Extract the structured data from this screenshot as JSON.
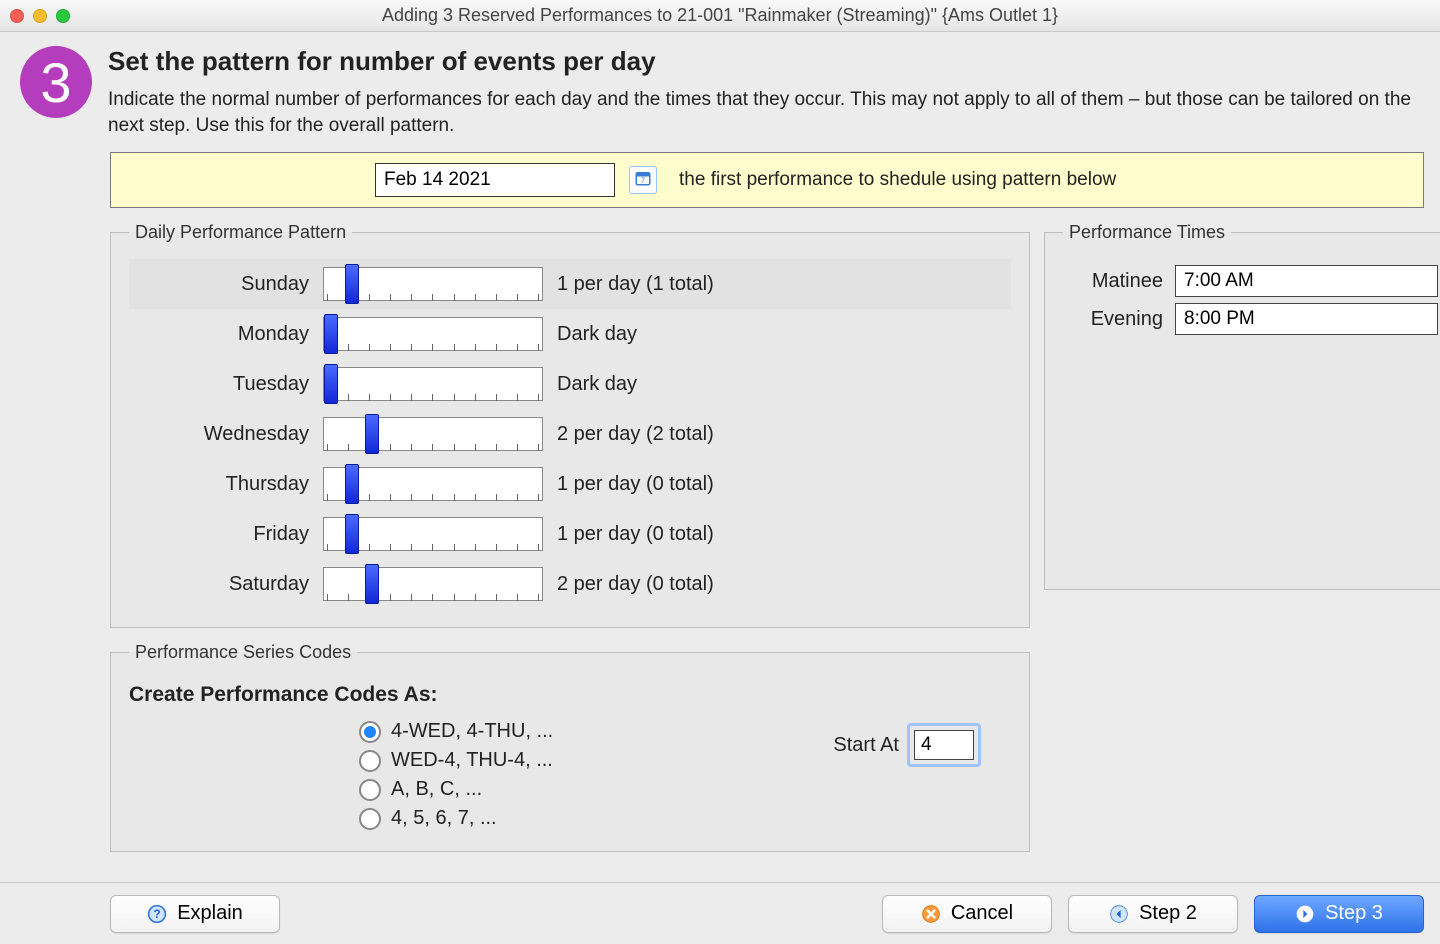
{
  "window": {
    "title": "Adding 3 Reserved Performances to 21-001 \"Rainmaker (Streaming)\" {Ams Outlet 1}"
  },
  "step": {
    "number": "3",
    "heading": "Set the pattern for number of events per day",
    "description": "Indicate the normal number of performances for each day and the times that they occur.  This may not apply to all of them – but those can be tailored on the next step.  Use this for the overall pattern."
  },
  "dateBar": {
    "value": "Feb 14 2021",
    "caption": "the first performance to shedule using pattern below"
  },
  "patternGroup": {
    "legend": "Daily Performance Pattern",
    "days": [
      {
        "label": "Sunday",
        "pos": 1,
        "value": "1 per day (1 total)",
        "striped": true
      },
      {
        "label": "Monday",
        "pos": 0,
        "value": "Dark day"
      },
      {
        "label": "Tuesday",
        "pos": 0,
        "value": "Dark day"
      },
      {
        "label": "Wednesday",
        "pos": 2,
        "value": "2 per day (2 total)"
      },
      {
        "label": "Thursday",
        "pos": 1,
        "value": "1 per day (0 total)"
      },
      {
        "label": "Friday",
        "pos": 1,
        "value": "1 per day (0 total)"
      },
      {
        "label": "Saturday",
        "pos": 2,
        "value": "2 per day (0 total)"
      }
    ],
    "sliderMax": 10
  },
  "codesGroup": {
    "legend": "Performance Series Codes",
    "heading": "Create Performance Codes As:",
    "options": [
      "4-WED, 4-THU, ...",
      "WED-4, THU-4, ...",
      "A, B, C, ...",
      "4, 5, 6, 7, ..."
    ],
    "selected": 0,
    "startAtLabel": "Start At",
    "startAtValue": "4"
  },
  "timesGroup": {
    "legend": "Performance Times",
    "rows": [
      {
        "label": "Matinee",
        "value": "7:00 AM"
      },
      {
        "label": "Evening",
        "value": "8:00 PM"
      }
    ]
  },
  "footer": {
    "explain": "Explain",
    "cancel": "Cancel",
    "step2": "Step 2",
    "step3": "Step 3"
  }
}
